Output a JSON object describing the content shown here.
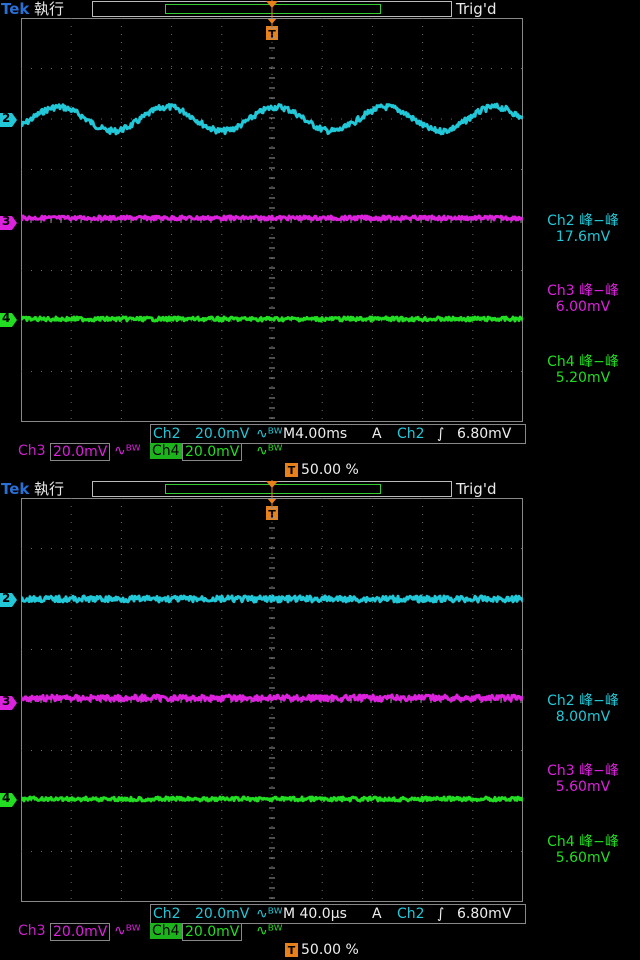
{
  "colors": {
    "ch2": "#22c8d8",
    "ch3": "#dd22dd",
    "ch4": "#22dd22",
    "grid": "#6a6a6a",
    "trigger": "#e8801b"
  },
  "screens": [
    {
      "brand": "Tek",
      "status": "執行",
      "trig_status": "Trig'd",
      "meas": [
        {
          "label": "Ch2 峰−峰",
          "value": "17.6mV"
        },
        {
          "label": "Ch3 峰−峰",
          "value": "6.00mV"
        },
        {
          "label": "Ch4 峰−峰",
          "value": "5.20mV"
        }
      ],
      "ch2_label": "Ch2",
      "ch2_scale": "20.0mV",
      "timebase": "M4.00ms",
      "trig_mode": "A",
      "trig_src": "Ch2",
      "trig_slope": "∫",
      "trig_level": "6.80mV",
      "ch3_label": "Ch3",
      "ch3_scale": "20.0mV",
      "ch4_label": "Ch4",
      "ch4_scale": "20.0mV",
      "trig_pos": "50.00 %",
      "traces": {
        "ch2": {
          "type": "sine",
          "amplitude": 12,
          "cycles": 4.6,
          "noise": 3
        },
        "ch3": {
          "noise": 2
        },
        "ch4": {
          "noise": 2
        }
      }
    },
    {
      "brand": "Tek",
      "status": "執行",
      "trig_status": "Trig'd",
      "meas": [
        {
          "label": "Ch2 峰−峰",
          "value": "8.00mV"
        },
        {
          "label": "Ch3 峰−峰",
          "value": "5.60mV"
        },
        {
          "label": "Ch4 峰−峰",
          "value": "5.60mV"
        }
      ],
      "ch2_label": "Ch2",
      "ch2_scale": "20.0mV",
      "timebase": "M 40.0µs",
      "trig_mode": "A",
      "trig_src": "Ch2",
      "trig_slope": "∫",
      "trig_level": "6.80mV",
      "ch3_label": "Ch3",
      "ch3_scale": "20.0mV",
      "ch4_label": "Ch4",
      "ch4_scale": "20.0mV",
      "trig_pos": "50.00 %",
      "traces": {
        "ch2": {
          "type": "flat",
          "noise": 3
        },
        "ch3": {
          "noise": 3
        },
        "ch4": {
          "noise": 2
        }
      }
    }
  ],
  "channel_markers": [
    "2",
    "3",
    "4"
  ],
  "trigger_marker": "T"
}
